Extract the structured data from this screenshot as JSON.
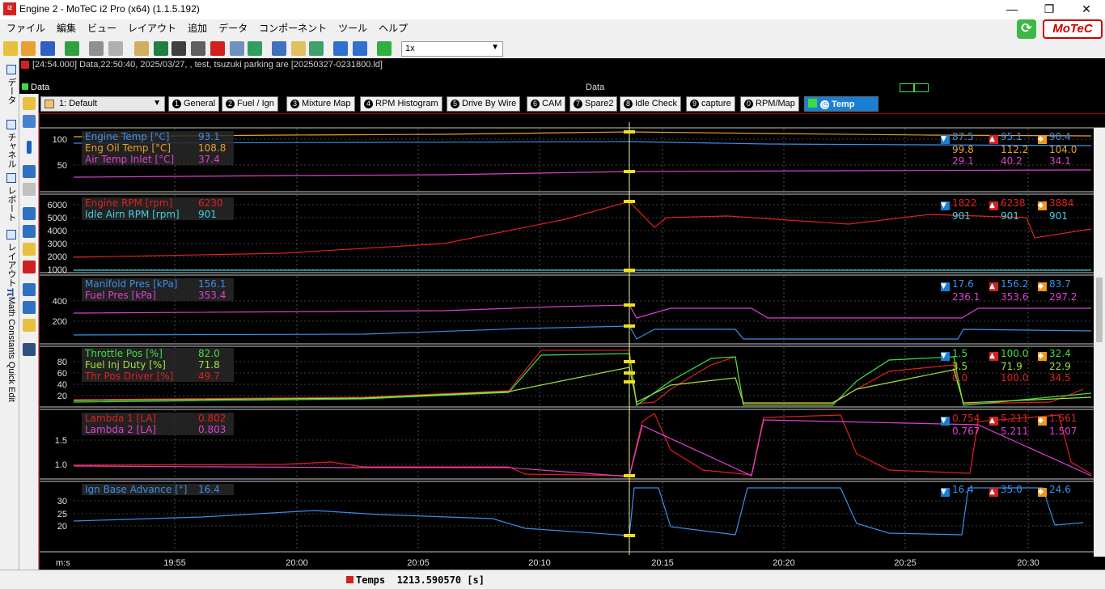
{
  "window": {
    "title": "Engine 2 - MoTeC i2 Pro (x64) (1.1.5.192)",
    "minimize": "—",
    "maximize": "❐",
    "close": "✕"
  },
  "menu": [
    "ファイル",
    "編集",
    "ビュー",
    "レイアウト",
    "追加",
    "データ",
    "コンポーネント",
    "ツール",
    "ヘルプ"
  ],
  "toolbar": {
    "zoom_value": "1x"
  },
  "brand": {
    "logo": "MoTeC",
    "refresh_icon": "refresh-icon"
  },
  "info_line": "[24:54.000] Data,22:50:40, 2025/03/27, , test, tsuzuki parking are [20250327-0231800.ld]",
  "data_strip": {
    "left_label": "Data",
    "title": "Data"
  },
  "side_tabs": [
    "データ",
    "チャネル",
    "レポート",
    "レイアウト",
    "Math Constants Quick Edit"
  ],
  "layout_selector": "1: Default",
  "tabs": [
    {
      "num": "1",
      "label": "General"
    },
    {
      "num": "2",
      "label": "Fuel / Ign"
    },
    {
      "num": "3",
      "label": "Mixture Map"
    },
    {
      "num": "4",
      "label": "RPM Histogram"
    },
    {
      "num": "5",
      "label": "Drive By Wire"
    },
    {
      "num": "6",
      "label": "CAM"
    },
    {
      "num": "7",
      "label": "Spare2"
    },
    {
      "num": "8",
      "label": "Idle Check"
    },
    {
      "num": "9",
      "label": "capture"
    },
    {
      "num": "0",
      "label": "RPM/Map"
    },
    {
      "num": "",
      "label": "Temp"
    }
  ],
  "x_axis": {
    "unit_label": "m:s",
    "ticks": [
      "19:55",
      "20:00",
      "20:05",
      "20:10",
      "20:15",
      "20:20",
      "20:25",
      "20:30"
    ]
  },
  "panes": [
    {
      "yticks": [
        "100",
        "50"
      ],
      "channels": [
        {
          "name": "Engine Temp [°C]",
          "value": "93.1",
          "color": "#3a8fe8",
          "min": "87.5",
          "max": "95.1",
          "avg": "90.4"
        },
        {
          "name": "Eng Oil Temp [°C]",
          "value": "108.8",
          "color": "#e8a030",
          "min": "99.8",
          "max": "112.2",
          "avg": "104.0"
        },
        {
          "name": "Air Temp Inlet [°C]",
          "value": "37.4",
          "color": "#e040d0",
          "min": "29.1",
          "max": "40.2",
          "avg": "34.1"
        }
      ]
    },
    {
      "yticks": [
        "6000",
        "5000",
        "4000",
        "3000",
        "2000",
        "1000"
      ],
      "channels": [
        {
          "name": "Engine RPM [rpm]",
          "value": "6230",
          "color": "#e02020",
          "min": "1822",
          "max": "6238",
          "avg": "3884"
        },
        {
          "name": "Idle Airn RPM [rpm]",
          "value": "901",
          "color": "#40d0e0",
          "min": "901",
          "max": "901",
          "avg": "901"
        }
      ]
    },
    {
      "yticks": [
        "400",
        "200"
      ],
      "channels": [
        {
          "name": "Manifold Pres [kPa]",
          "value": "156.1",
          "color": "#3a8fe8",
          "min": "17.6",
          "max": "156.2",
          "avg": "83.7"
        },
        {
          "name": "Fuel Pres [kPa]",
          "value": "353.4",
          "color": "#e040d0",
          "min": "236.1",
          "max": "353.6",
          "avg": "297.2"
        }
      ]
    },
    {
      "yticks": [
        "80",
        "60",
        "40",
        "20"
      ],
      "channels": [
        {
          "name": "Throttle Pos [%]",
          "value": "82.0",
          "color": "#40e040",
          "min": "1.5",
          "max": "100.0",
          "avg": "32.4"
        },
        {
          "name": "Fuel Inj Duty [%]",
          "value": "71.8",
          "color": "#a0e040",
          "min": "3.5",
          "max": "71.9",
          "avg": "22.9"
        },
        {
          "name": "Thr Pos Driver [%]",
          "value": "49.7",
          "color": "#e02020",
          "min": "0.0",
          "max": "100.0",
          "avg": "34.5"
        }
      ]
    },
    {
      "yticks": [
        "1.5",
        "1.0"
      ],
      "channels": [
        {
          "name": "Lambda 1 [LA]",
          "value": "0.802",
          "color": "#e02020",
          "min": "0.754",
          "max": "5.211",
          "avg": "1.561"
        },
        {
          "name": "Lambda 2 [LA]",
          "value": "0.803",
          "color": "#e040d0",
          "min": "0.767",
          "max": "5.211",
          "avg": "1.507"
        }
      ]
    },
    {
      "yticks": [
        "30",
        "25",
        "20"
      ],
      "channels": [
        {
          "name": "Ign Base Advance [°]",
          "value": "16.4",
          "color": "#3a8fe8",
          "min": "16.4",
          "max": "35.0",
          "avg": "24.6"
        }
      ]
    }
  ],
  "status": {
    "label": "Temps",
    "value": "1213.590570 [s]"
  }
}
